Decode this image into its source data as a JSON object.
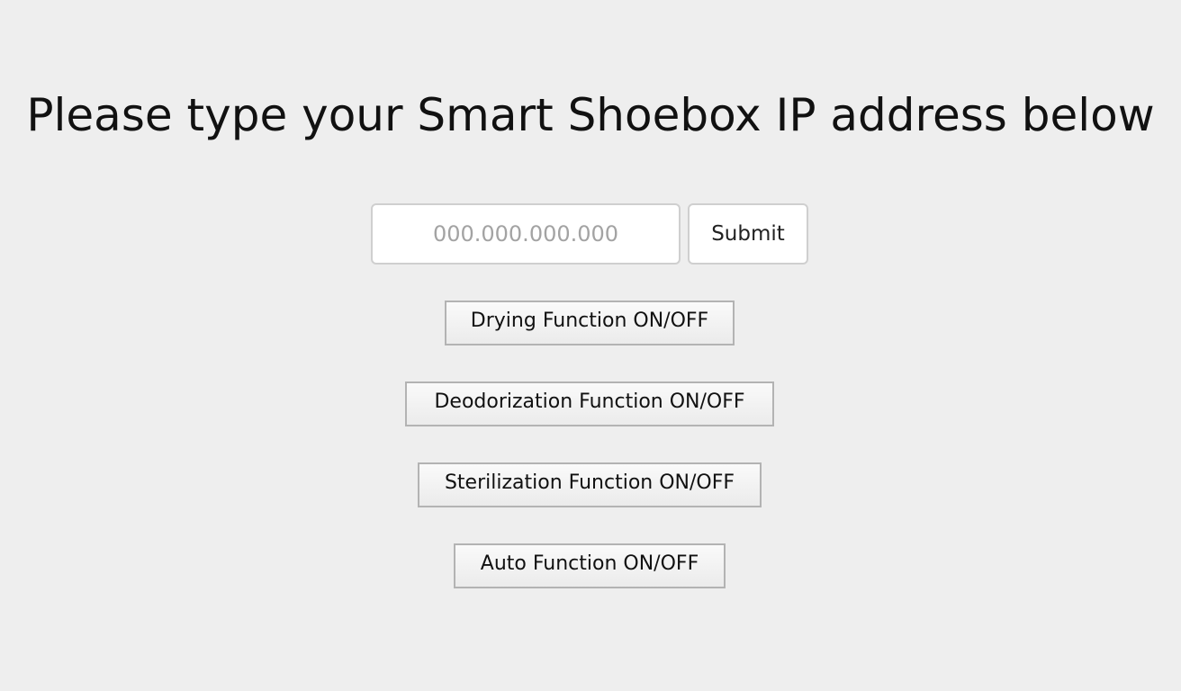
{
  "heading": "Please type your Smart Shoebox IP address below",
  "ip_form": {
    "input_value": "",
    "input_placeholder": "000.000.000.000",
    "submit_label": "Submit"
  },
  "functions": {
    "drying_label": "Drying Function ON/OFF",
    "deodorization_label": "Deodorization Function ON/OFF",
    "sterilization_label": "Sterilization Function ON/OFF",
    "auto_label": "Auto Function ON/OFF"
  },
  "colors": {
    "background": "#eeeeee",
    "text": "#111111",
    "placeholder": "#a3a3a3"
  }
}
